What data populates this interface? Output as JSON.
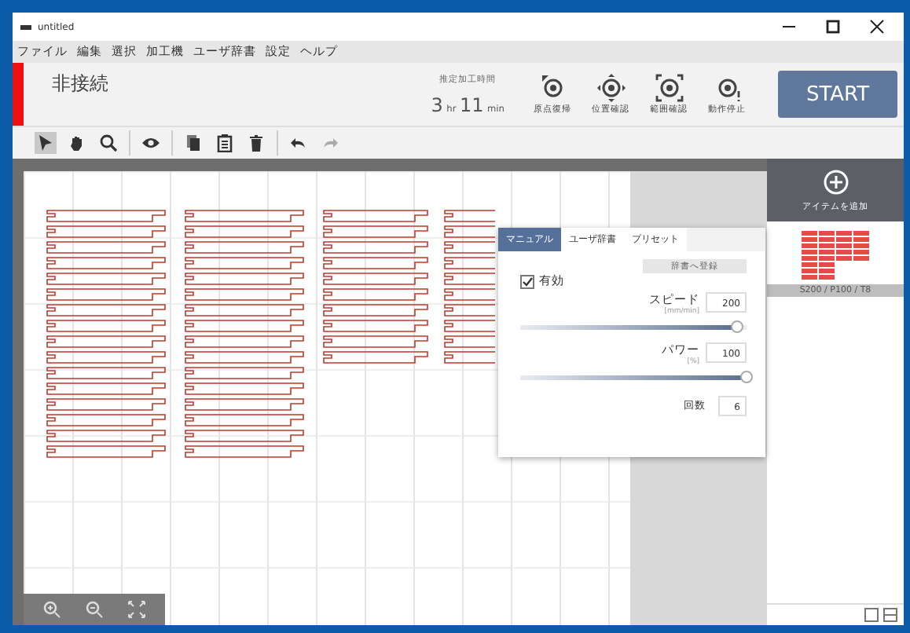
{
  "window": {
    "title": "untitled"
  },
  "menu": [
    "ファイル",
    "編集",
    "選択",
    "加工機",
    "ユーザ辞書",
    "設定",
    "ヘルプ"
  ],
  "status": {
    "label": "非接続",
    "connected": false
  },
  "estimate": {
    "label": "推定加工時間",
    "hours": "3",
    "hours_unit": "hr",
    "minutes": "11",
    "minutes_unit": "min"
  },
  "actions": [
    {
      "kind": "origin",
      "label": "原点復帰"
    },
    {
      "kind": "position",
      "label": "位置確認"
    },
    {
      "kind": "range",
      "label": "範囲確認"
    },
    {
      "kind": "stop",
      "label": "動作停止"
    }
  ],
  "start_button": "START",
  "toolbar": [
    {
      "kind": "pointer",
      "selected": true
    },
    {
      "kind": "hand",
      "selected": false
    },
    {
      "kind": "zoom",
      "selected": false
    },
    {
      "kind": "eye",
      "selected": false
    },
    {
      "kind": "copy",
      "selected": false
    },
    {
      "kind": "paste",
      "selected": false
    },
    {
      "kind": "delete",
      "selected": false
    },
    {
      "kind": "undo",
      "selected": false
    },
    {
      "kind": "redo",
      "selected": false
    }
  ],
  "settings_panel": {
    "tabs": [
      {
        "label": "マニュアル",
        "selected": true
      },
      {
        "label": "ユーザ辞書",
        "selected": false
      },
      {
        "label": "プリセット",
        "selected": false
      }
    ],
    "enabled": {
      "label": "有効",
      "checked": true
    },
    "register_button": "辞書へ登録",
    "speed": {
      "label": "スピード",
      "unit": "[mm/min]",
      "value": "200",
      "level": 0.96
    },
    "power": {
      "label": "パワー",
      "unit": "[%]",
      "value": "100",
      "level": 1.0
    },
    "count": {
      "label": "回数",
      "value": "6"
    }
  },
  "sidebar": {
    "add_label": "アイテムを追加",
    "item_caption": "S200 / P100 / T8"
  }
}
